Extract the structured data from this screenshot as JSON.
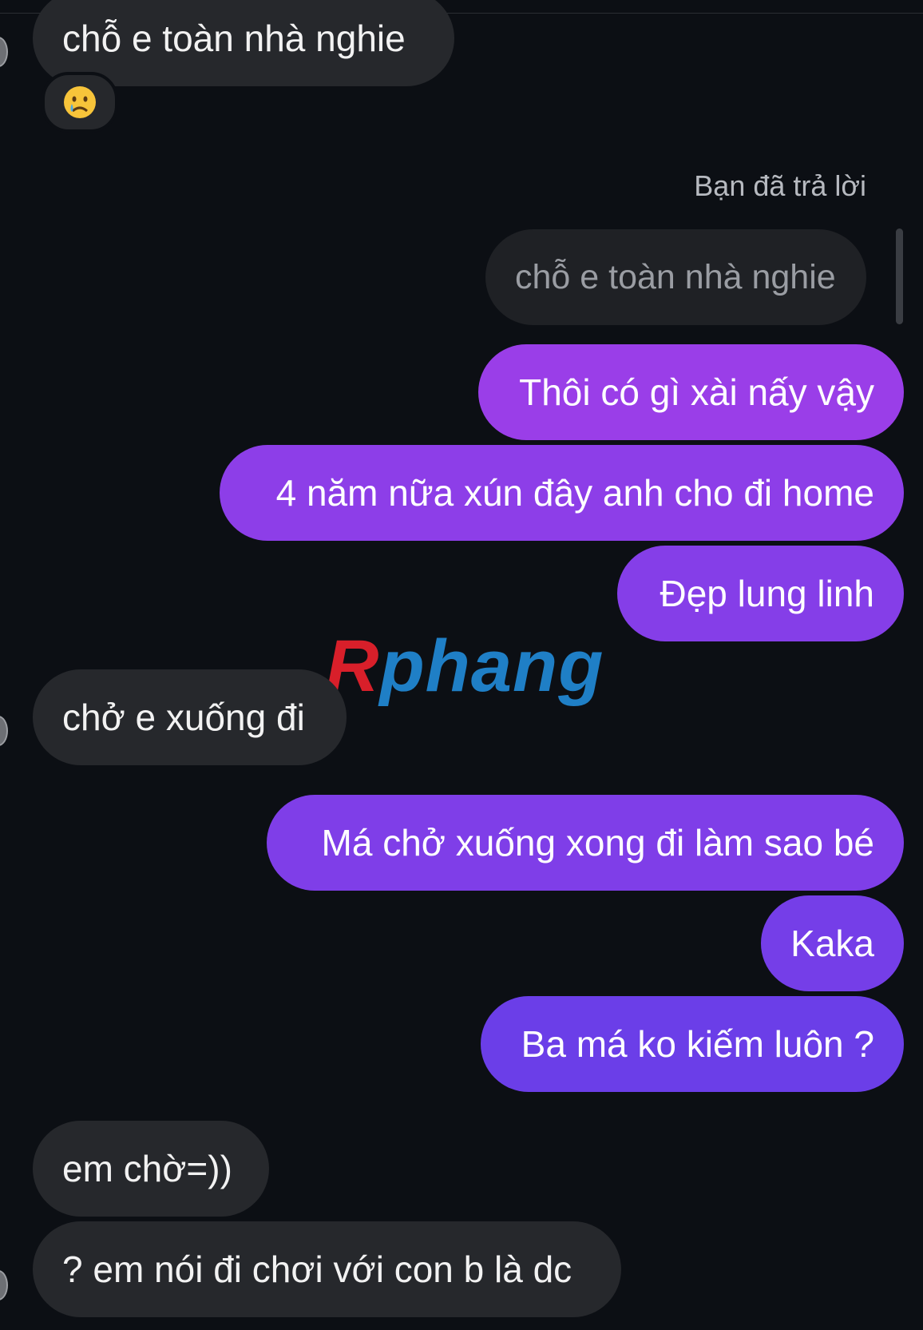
{
  "thread": {
    "messages_top": {
      "first": "chỗ e toàn nhà nghie",
      "reaction_icon": "crying-face-emoji"
    },
    "reply": {
      "label": "Bạn đã trả lời",
      "quoted_text": "chỗ e toàn nhà nghie"
    },
    "outgoing_1": [
      "Thôi có gì xài nấy vậy",
      "4 năm nữa xún đây anh cho đi home",
      "Đẹp lung linh"
    ],
    "incoming_1": "chở e xuống đi",
    "outgoing_2": [
      "Má chở xuống xong đi làm sao bé",
      "Kaka",
      "Ba má ko kiếm luôn ?"
    ],
    "incoming_2": [
      "em chờ=))",
      "? em nói đi chơi với con b là dc"
    ]
  },
  "watermark": {
    "first_letter": "R",
    "rest": "phang"
  },
  "colors": {
    "background": "#0c0f14",
    "incoming_bubble": "#26282c",
    "outgoing_gradient_top": "#9b3ee8",
    "outgoing_gradient_bottom": "#6a3ee8"
  }
}
